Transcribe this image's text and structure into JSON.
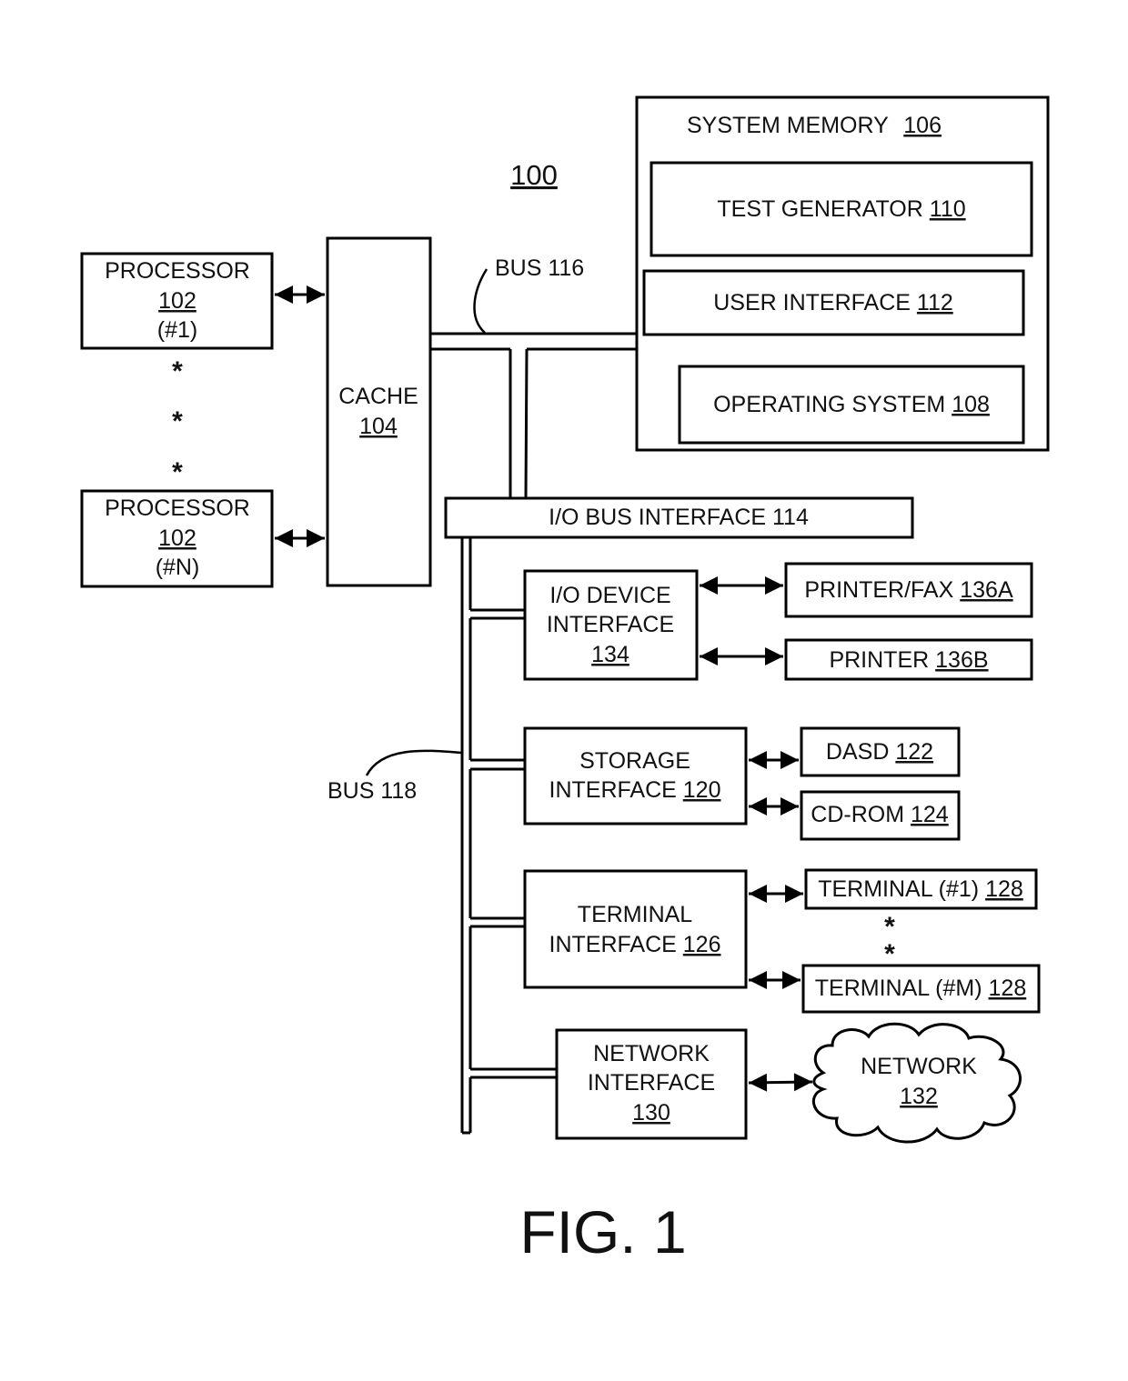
{
  "figure": {
    "ref_number": "100",
    "caption": "FIG. 1"
  },
  "processors": [
    {
      "title": "PROCESSOR",
      "ref": "102",
      "index": "(#1)"
    },
    {
      "title": "PROCESSOR",
      "ref": "102",
      "index": "(#N)"
    }
  ],
  "ellipsis": "*",
  "cache": {
    "title": "CACHE",
    "ref": "104"
  },
  "bus116": {
    "label": "BUS 116"
  },
  "bus118": {
    "label": "BUS 118"
  },
  "system_memory": {
    "title": "SYSTEM MEMORY",
    "ref": "106",
    "components": [
      {
        "title": "TEST GENERATOR",
        "ref": "110"
      },
      {
        "title": "USER INTERFACE",
        "ref": "112"
      },
      {
        "title": "OPERATING SYSTEM",
        "ref": "108"
      }
    ]
  },
  "io_bus_interface": {
    "label": "I/O BUS INTERFACE 114"
  },
  "io_device_interface": {
    "line1": "I/O DEVICE",
    "line2": "INTERFACE",
    "ref": "134"
  },
  "printer_fax": {
    "title": "PRINTER/FAX",
    "ref": "136A"
  },
  "printer": {
    "title": "PRINTER",
    "ref": "136B"
  },
  "storage_interface": {
    "line1": "STORAGE",
    "line2": "INTERFACE",
    "ref": "120"
  },
  "dasd": {
    "title": "DASD",
    "ref": "122"
  },
  "cdrom": {
    "title": "CD-ROM",
    "ref": "124"
  },
  "terminal_interface": {
    "line1": "TERMINAL",
    "line2": "INTERFACE",
    "ref": "126"
  },
  "terminals": [
    {
      "title": "TERMINAL (#1)",
      "ref": "128"
    },
    {
      "title": "TERMINAL (#M)",
      "ref": "128"
    }
  ],
  "network_interface": {
    "line1": "NETWORK",
    "line2": "INTERFACE",
    "ref": "130"
  },
  "network": {
    "title": "NETWORK",
    "ref": "132"
  }
}
